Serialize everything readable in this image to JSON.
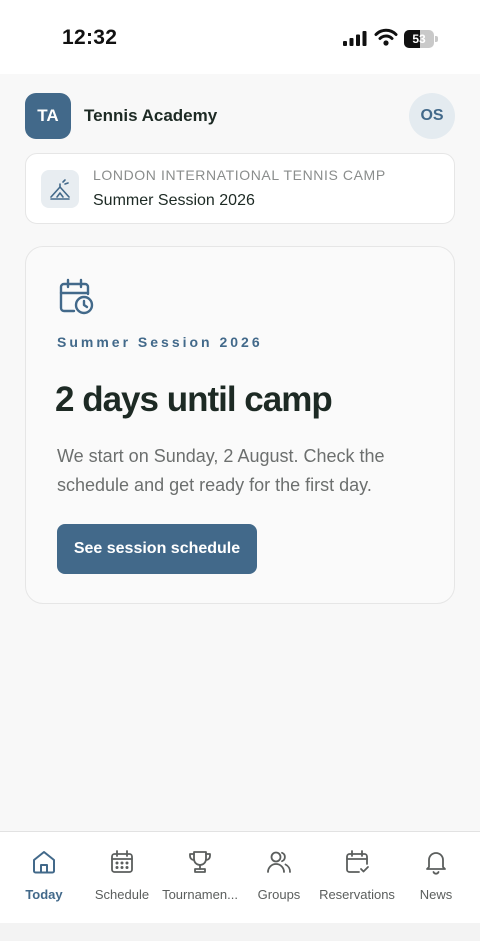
{
  "status_bar": {
    "time": "12:32",
    "battery": "53",
    "battery_level": 0.53
  },
  "header": {
    "org_initials": "TA",
    "org_name": "Tennis Academy",
    "user_initials": "OS"
  },
  "camp": {
    "icon": "tennis-camp-icon",
    "name": "LONDON INTERNATIONAL TENNIS CAMP",
    "session": "Summer Session 2026"
  },
  "countdown": {
    "icon": "calendar-clock-icon",
    "eyebrow": "Summer Session 2026",
    "title": "2 days until camp",
    "description": "We start on Sunday, 2 August. Check the schedule and get ready for the first day.",
    "button_label": "See session schedule"
  },
  "nav": {
    "items": [
      {
        "label": "Today",
        "icon": "home-icon",
        "active": true
      },
      {
        "label": "Schedule",
        "icon": "calendar-icon",
        "active": false
      },
      {
        "label": "Tournamen...",
        "icon": "trophy-icon",
        "active": false
      },
      {
        "label": "Groups",
        "icon": "users-icon",
        "active": false
      },
      {
        "label": "Reservations",
        "icon": "calendar-check-icon",
        "active": false
      },
      {
        "label": "News",
        "icon": "bell-icon",
        "active": false
      }
    ]
  },
  "colors": {
    "accent": "#42698a",
    "text_primary": "#1d2a24",
    "text_muted": "#6c6f6e",
    "background": "#f8f8f8"
  }
}
